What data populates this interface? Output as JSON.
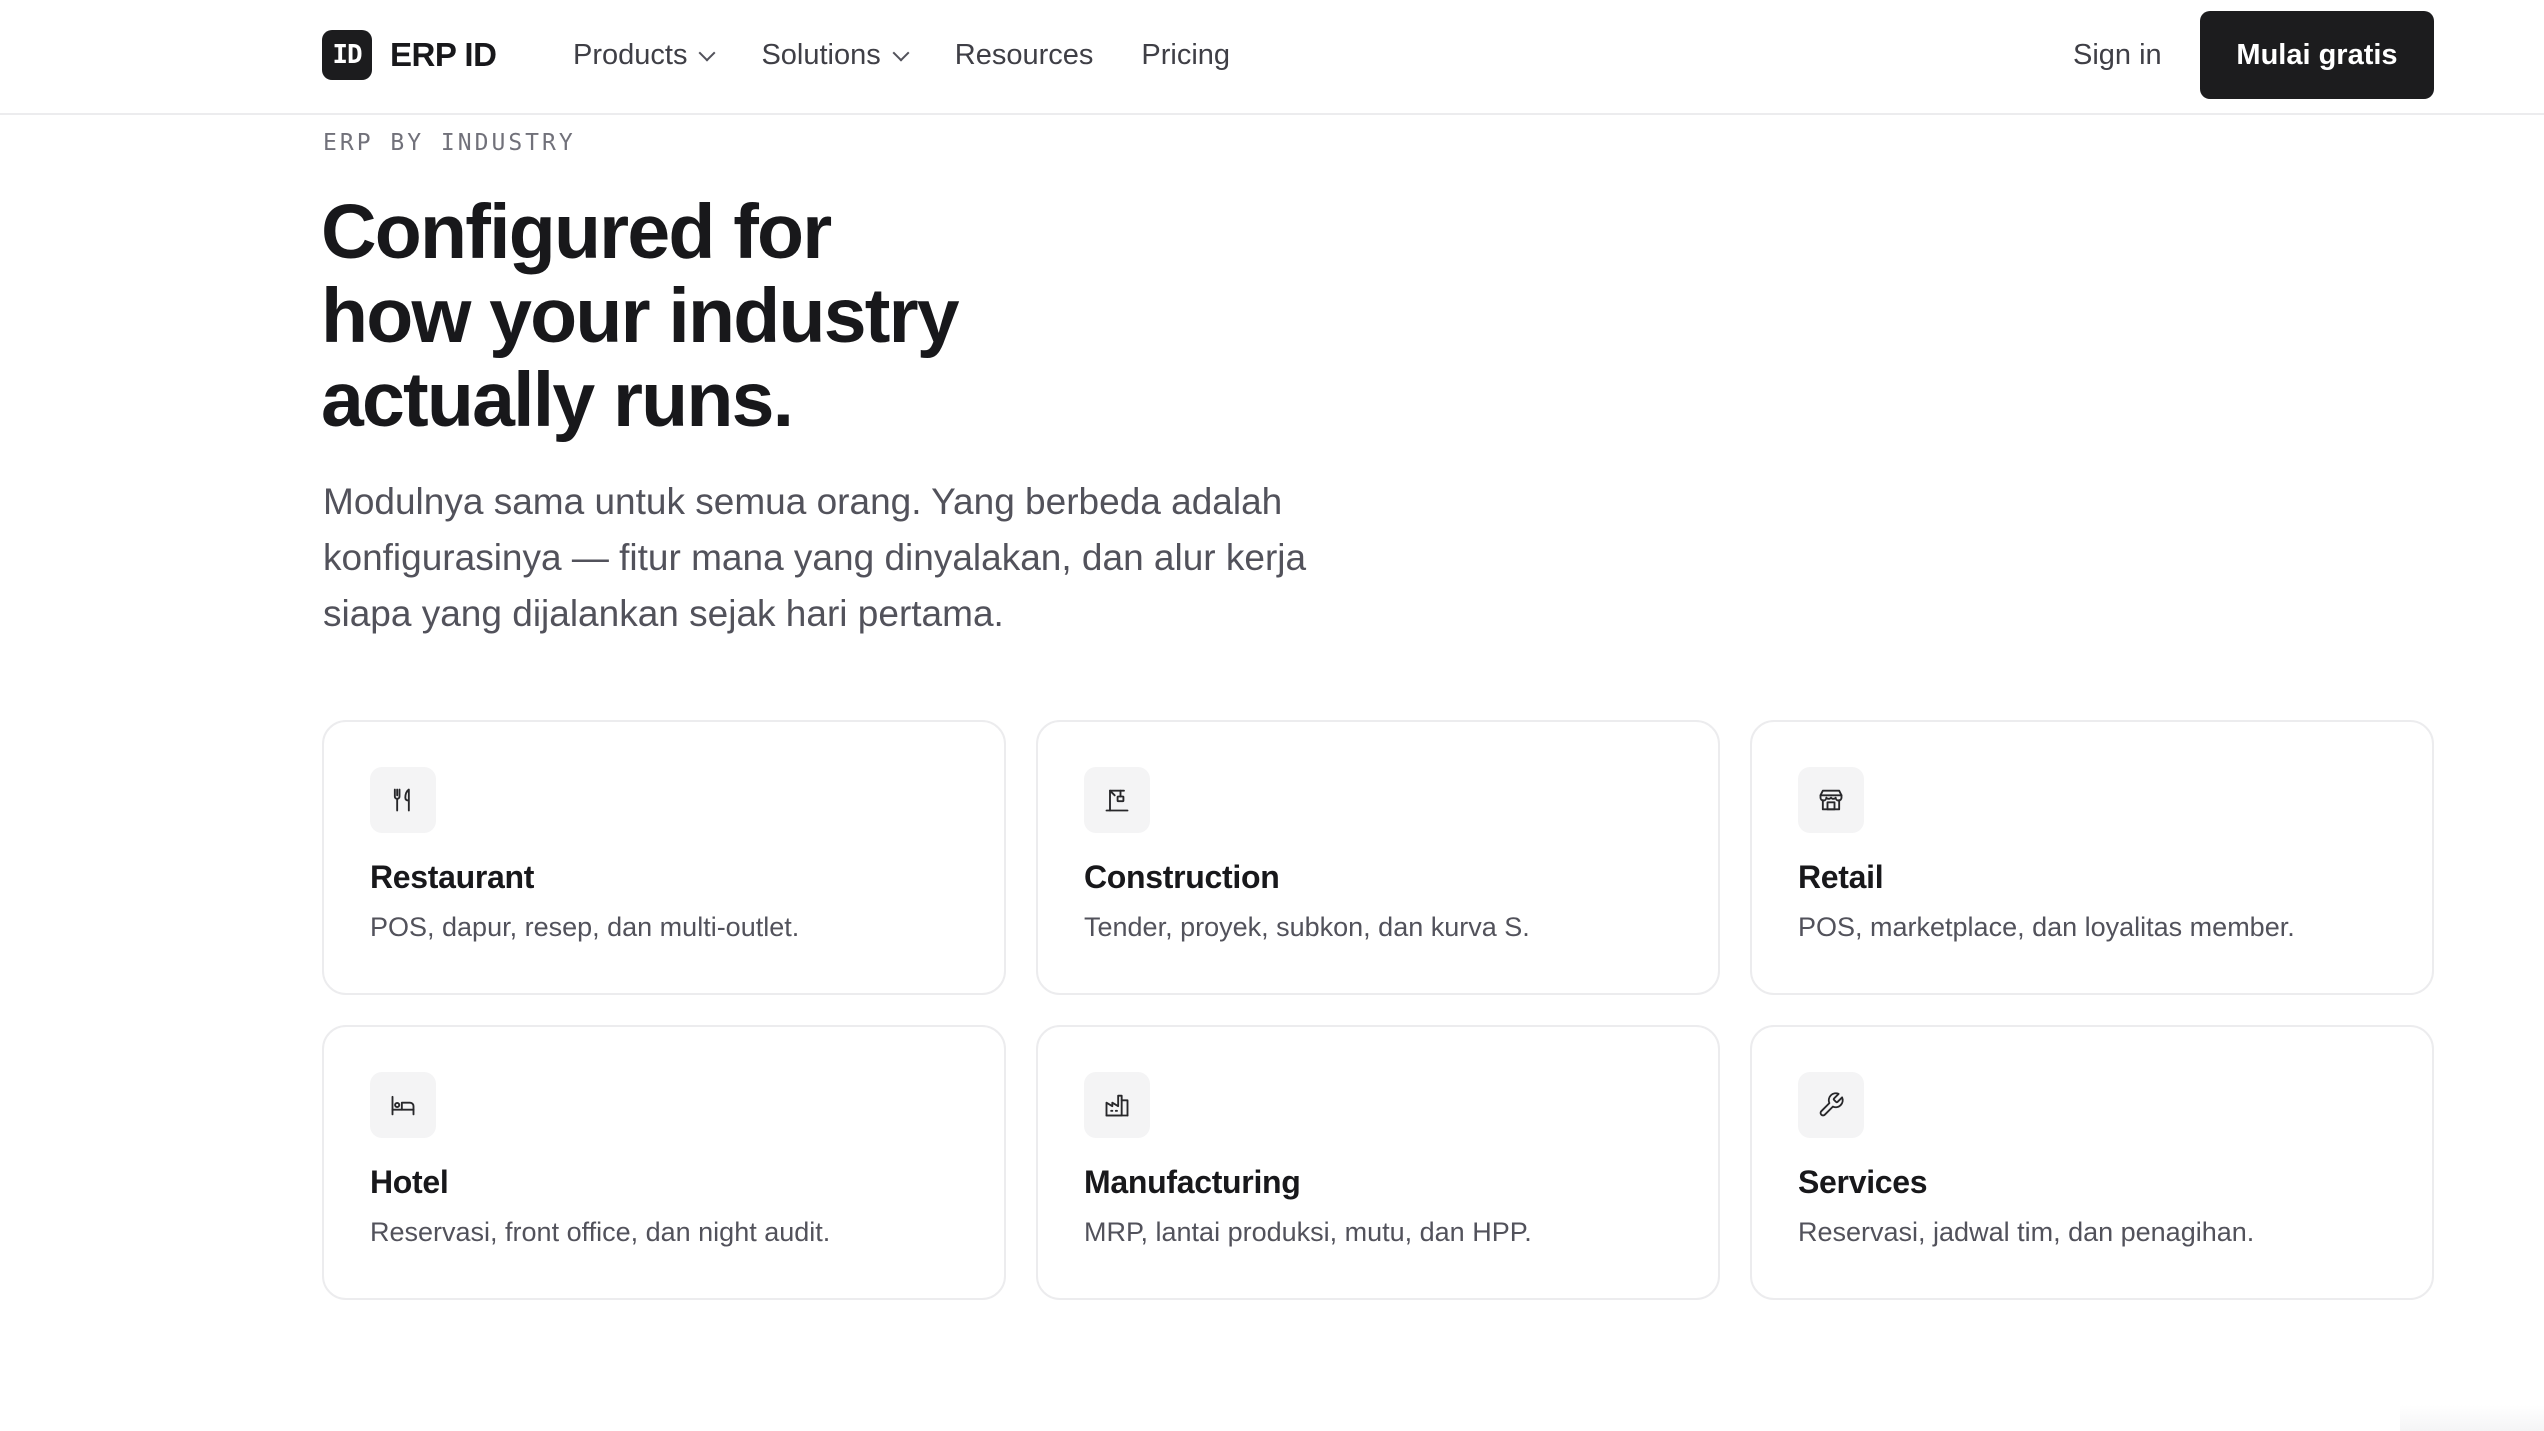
{
  "nav": {
    "logo_mark": "ID",
    "brand": "ERP ID",
    "links": [
      {
        "label": "Products",
        "dropdown": true
      },
      {
        "label": "Solutions",
        "dropdown": true
      },
      {
        "label": "Resources",
        "dropdown": false
      },
      {
        "label": "Pricing",
        "dropdown": false
      }
    ],
    "sign_in": "Sign in",
    "cta": "Mulai gratis"
  },
  "hero": {
    "eyebrow": "ERP BY INDUSTRY",
    "title_lines": [
      "Configured for",
      "how your industry",
      "actually runs."
    ],
    "subtitle_lines": [
      "Modulnya sama untuk semua orang. Yang berbeda adalah",
      "konfigurasinya — fitur mana yang dinyalakan, dan alur kerja",
      "siapa yang dijalankan sejak hari pertama."
    ]
  },
  "industries": [
    {
      "icon": "utensils-icon",
      "title": "Restaurant",
      "desc": "POS, dapur, resep, dan multi-outlet."
    },
    {
      "icon": "crane-icon",
      "title": "Construction",
      "desc": "Tender, proyek, subkon, dan kurva S."
    },
    {
      "icon": "store-icon",
      "title": "Retail",
      "desc": "POS, marketplace, dan loyalitas member."
    },
    {
      "icon": "bed-icon",
      "title": "Hotel",
      "desc": "Reservasi, front office, dan night audit."
    },
    {
      "icon": "factory-icon",
      "title": "Manufacturing",
      "desc": "MRP, lantai produksi, mutu, dan HPP."
    },
    {
      "icon": "wrench-icon",
      "title": "Services",
      "desc": "Reservasi, jadwal tim, dan penagihan."
    }
  ],
  "colors": {
    "ink": "#18181b",
    "muted": "#52525b",
    "border": "#ececee",
    "icon_bg": "#f4f4f5",
    "button_bg": "#1c1c1e"
  }
}
